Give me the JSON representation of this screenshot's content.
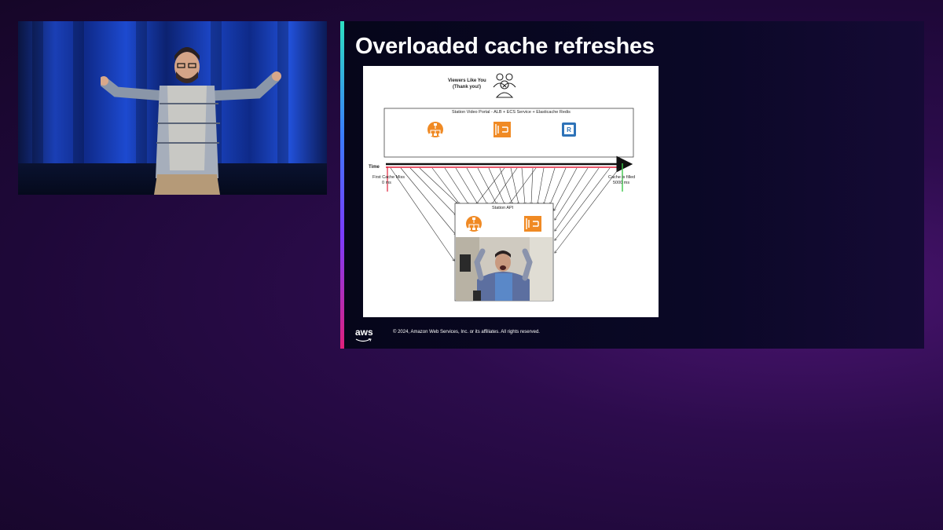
{
  "slide": {
    "title": "Overloaded cache refreshes",
    "copyright": "© 2024, Amazon Web Services, Inc. or its affiliates. All rights reserved.",
    "logo_text": "aws",
    "accent_colors": [
      "#2de0c0",
      "#3a7cff",
      "#7a3cff",
      "#e0207a"
    ]
  },
  "diagram": {
    "viewers_label_line1": "Viewers Like You",
    "viewers_label_line2": "(Thank you!)",
    "portal_label": "Station Video Portal - ALB + ECS Service + Elasticache Redis",
    "time_label": "Time",
    "first_miss_line1": "First Cache Miss",
    "first_miss_line2": "0 ms",
    "cache_filled_line1": "Cache is filled",
    "cache_filled_line2": "5000 ms",
    "api_label": "Station API",
    "colors": {
      "orange": "#f08a24",
      "redis_blue": "#2e73b8",
      "timeline_red": "#e0203a",
      "end_green": "#3cc84a"
    },
    "icons": [
      "users-icon",
      "load-balancer-icon",
      "ecs-icon",
      "redis-icon"
    ]
  }
}
